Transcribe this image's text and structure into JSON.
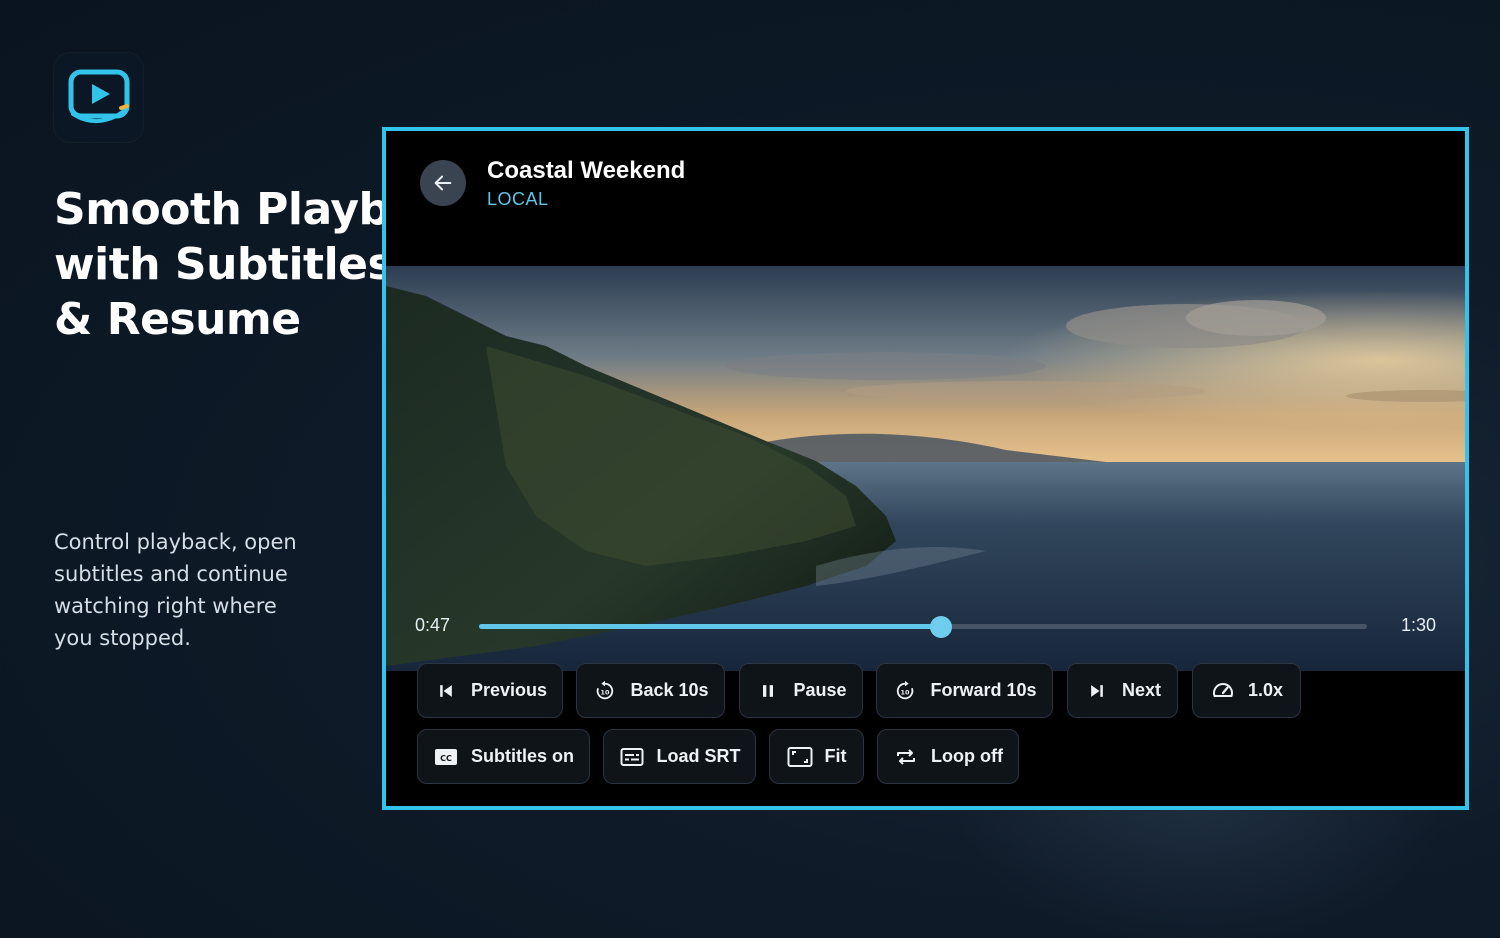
{
  "promo": {
    "headline_lines": [
      "Smooth Playback",
      "with Subtitles",
      "& Resume"
    ],
    "description": "Control playback, open subtitles and continue watching right where you stopped."
  },
  "player": {
    "title": "Coastal Weekend",
    "source": "LOCAL",
    "current_time": "0:47",
    "total_time": "1:30",
    "progress_fraction": 0.52,
    "accent_color": "#5fc6e9",
    "frame_color": "#31c3ea"
  },
  "controls": {
    "row1": [
      {
        "label": "Previous",
        "icon": "skip-previous-icon"
      },
      {
        "label": "Back 10s",
        "icon": "replay-10-icon"
      },
      {
        "label": "Pause",
        "icon": "pause-icon"
      },
      {
        "label": "Forward 10s",
        "icon": "forward-10-icon"
      },
      {
        "label": "Next",
        "icon": "skip-next-icon"
      },
      {
        "label": "1.0x",
        "icon": "speed-gauge-icon"
      }
    ],
    "row2": [
      {
        "label": "Subtitles on",
        "icon": "closed-captions-icon"
      },
      {
        "label": "Load SRT",
        "icon": "subtitle-file-icon"
      },
      {
        "label": "Fit",
        "icon": "aspect-fit-icon"
      },
      {
        "label": "Loop off",
        "icon": "loop-icon"
      }
    ]
  }
}
